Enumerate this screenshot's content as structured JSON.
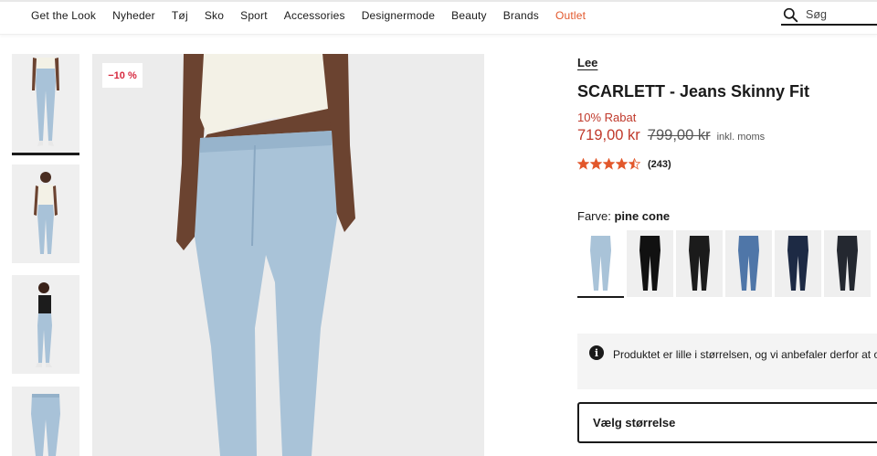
{
  "nav": {
    "items": [
      "Get the Look",
      "Nyheder",
      "Tøj",
      "Sko",
      "Sport",
      "Accessories",
      "Designermode",
      "Beauty",
      "Brands",
      "Outlet"
    ],
    "search_placeholder": "Søg",
    "search_icon": "magnifier"
  },
  "gallery": {
    "discount_badge": "−10 %",
    "thumbnails": [
      "model-front-full",
      "model-front-top",
      "model-side",
      "product-flat"
    ],
    "active_thumbnail": 0
  },
  "product": {
    "brand": "Lee",
    "title": "SCARLETT - Jeans Skinny Fit",
    "discount_label": "10% Rabat",
    "price_now": "719,00 kr",
    "price_old": "799,00 kr",
    "vat_note": "inkl. moms",
    "rating_value": 4.5,
    "rating_count": "(243)",
    "star_color": "#e2572b",
    "sale_color": "#c0392b"
  },
  "color": {
    "label": "Farve:",
    "selected": "pine cone",
    "swatches": [
      {
        "name": "pine cone",
        "hex": "#a9c3d8"
      },
      {
        "name": "black",
        "hex": "#111111"
      },
      {
        "name": "black-washed",
        "hex": "#1b1b1b"
      },
      {
        "name": "mid blue",
        "hex": "#4f76a8"
      },
      {
        "name": "dark navy",
        "hex": "#1d2a44"
      },
      {
        "name": "charcoal",
        "hex": "#242830"
      }
    ]
  },
  "size_note": {
    "icon": "info-icon",
    "text": "Produktet er lille i størrelsen, og vi anbefaler derfor at op"
  },
  "size_select": {
    "label": "Vælg størrelse"
  }
}
